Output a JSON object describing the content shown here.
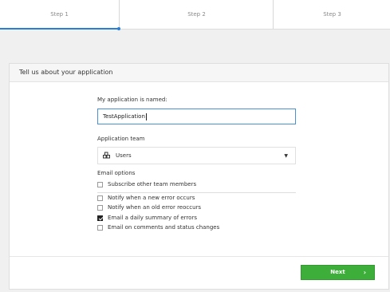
{
  "steps": [
    {
      "label": "Step 1"
    },
    {
      "label": "Step 2"
    },
    {
      "label": "Step 3"
    }
  ],
  "panel": {
    "title": "Tell us about your application"
  },
  "form": {
    "name_label": "My application is named:",
    "name_value": "TestApplication",
    "team_label": "Application team",
    "team_value": "Users",
    "email_label": "Email options"
  },
  "email_options": [
    {
      "label": "Subscribe other team members",
      "checked": false
    },
    {
      "label": "Notify when a new error occurs",
      "checked": false
    },
    {
      "label": "Notify when an old error reoccurs",
      "checked": false
    },
    {
      "label": "Email a daily summary of errors",
      "checked": true
    },
    {
      "label": "Email on comments and status changes",
      "checked": false
    }
  ],
  "footer": {
    "next_label": "Next"
  },
  "colors": {
    "accent": "#2a7fd4",
    "primary_button": "#3dae3a"
  }
}
